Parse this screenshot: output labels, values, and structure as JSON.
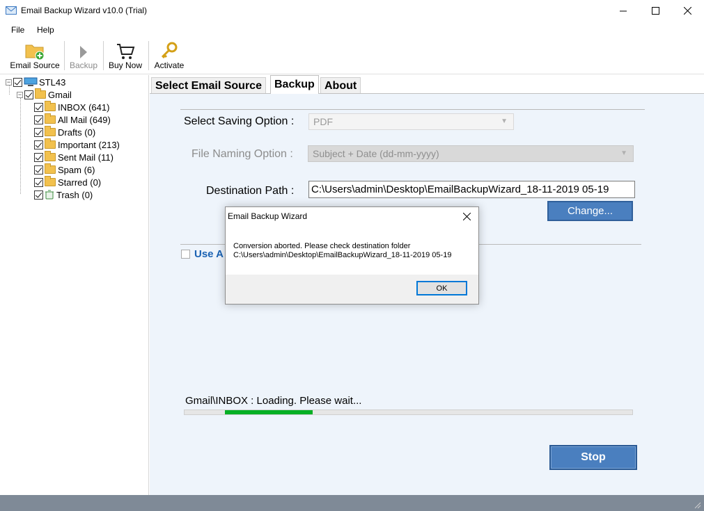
{
  "window": {
    "title": "Email Backup Wizard v10.0 (Trial)",
    "controls": {
      "minimize": "—",
      "maximize": "☐",
      "close": "✕"
    }
  },
  "menu": {
    "file": "File",
    "help": "Help"
  },
  "toolbar": {
    "email_source": "Email Source",
    "backup": "Backup",
    "buy_now": "Buy Now",
    "activate": "Activate"
  },
  "tree": {
    "root": "STL43",
    "account": "Gmail",
    "folders": [
      {
        "label": "INBOX (641)"
      },
      {
        "label": "All Mail (649)"
      },
      {
        "label": "Drafts (0)"
      },
      {
        "label": "Important (213)"
      },
      {
        "label": "Sent Mail (11)"
      },
      {
        "label": "Spam (6)"
      },
      {
        "label": "Starred (0)"
      },
      {
        "label": "Trash (0)"
      }
    ]
  },
  "tabs": [
    {
      "label": "Select Email Source"
    },
    {
      "label": "Backup"
    },
    {
      "label": "About"
    }
  ],
  "backup": {
    "saving_option_label": "Select Saving Option :",
    "saving_option_value": "PDF",
    "naming_option_label": "File Naming Option :",
    "naming_option_value": "Subject + Date (dd-mm-yyyy)",
    "destination_label": "Destination Path :",
    "destination_value": "C:\\Users\\admin\\Desktop\\EmailBackupWizard_18-11-2019 05-19",
    "change_button": "Change...",
    "use_advance": "Use A",
    "progress_text": "Gmail\\INBOX : Loading. Please wait...",
    "progress_fraction": 0.196,
    "stop_button": "Stop"
  },
  "dialog": {
    "title": "Email Backup Wizard",
    "message_line1": "Conversion aborted. Please check destination folder",
    "message_line2": "C:\\Users\\admin\\Desktop\\EmailBackupWizard_18-11-2019 05-19",
    "ok_button": "OK"
  },
  "colors": {
    "accent_button": "#4a7fbf",
    "progress": "#06b025",
    "panel_bg": "#eef4fb",
    "link_blue": "#1a62b3"
  }
}
